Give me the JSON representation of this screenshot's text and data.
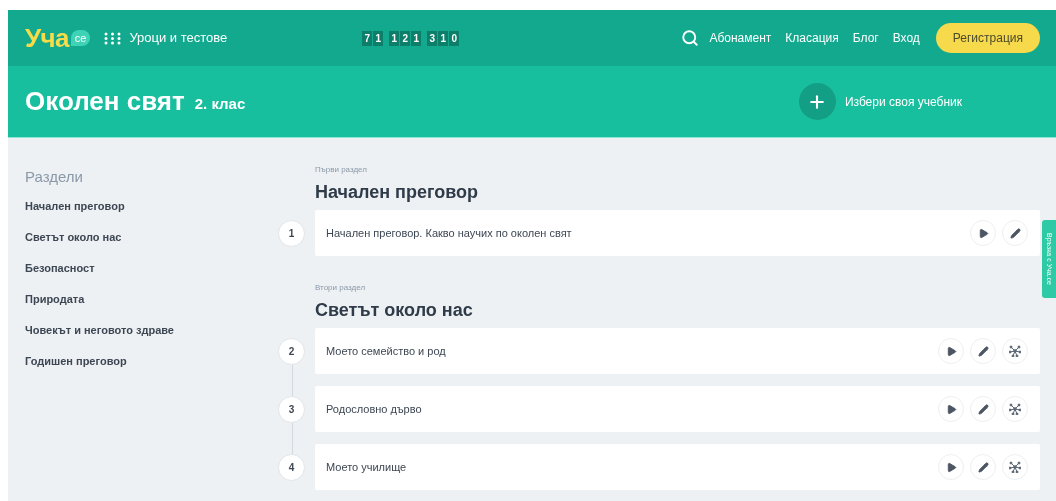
{
  "header": {
    "logo": {
      "main": "Уча",
      "bubble": "се"
    },
    "menu_label": "Уроци и тестове",
    "counter_groups": [
      [
        "7",
        "1"
      ],
      [
        "1",
        "2",
        "1"
      ],
      [
        "3",
        "1",
        "0"
      ]
    ],
    "nav_links": [
      "Абонамент",
      "Класация",
      "Блог",
      "Вход"
    ],
    "register_button": "Регистрация"
  },
  "subject": {
    "title": "Околен свят",
    "grade": "2. клас",
    "choose_textbook": "Избери своя учебник"
  },
  "sidebar": {
    "heading": "Раздели",
    "items": [
      "Начален преговор",
      "Светът около нас",
      "Безопасност",
      "Природата",
      "Човекът и неговото здраве",
      "Годишен преговор"
    ]
  },
  "sections": [
    {
      "label": "Първи раздел",
      "title": "Начален преговор",
      "lessons": [
        {
          "number": "1",
          "title": "Начален преговор. Какво научих по околен свят",
          "actions": [
            {
              "kind": "play"
            },
            {
              "kind": "edit"
            }
          ]
        }
      ]
    },
    {
      "label": "Втори раздел",
      "title": "Светът около нас",
      "lessons": [
        {
          "number": "2",
          "title": "Моето семейство и род",
          "actions": [
            {
              "kind": "play"
            },
            {
              "kind": "edit"
            },
            {
              "kind": "network"
            }
          ]
        },
        {
          "number": "3",
          "title": "Родословно дърво",
          "actions": [
            {
              "kind": "play"
            },
            {
              "kind": "edit"
            },
            {
              "kind": "network"
            }
          ]
        },
        {
          "number": "4",
          "title": "Моето училище",
          "actions": [
            {
              "kind": "play"
            },
            {
              "kind": "edit"
            },
            {
              "kind": "network"
            }
          ]
        }
      ]
    }
  ],
  "feedback_tab": "Връзка с Уча.се"
}
